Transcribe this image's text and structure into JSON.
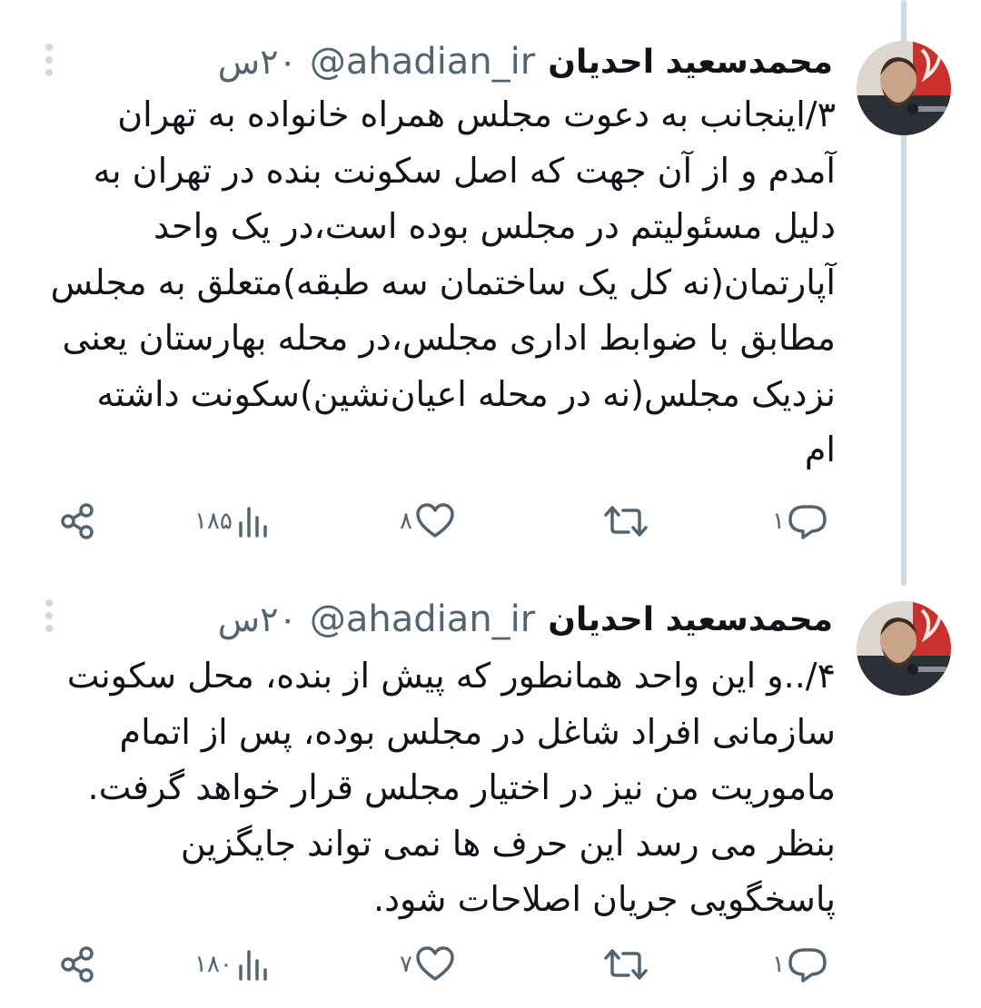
{
  "tweets": [
    {
      "author_name": "محمدسعید احدیان",
      "handle": "@ahadian_ir",
      "time": "۲۰س",
      "body_lines": [
        "۳/اینجانب به دعوت مجلس  همراه خانواده به تهران",
        "آمدم و از آن جهت که اصل سکونت بنده در تهران به",
        "دلیل مسئولیتم در مجلس بوده است،در  یک واحد",
        "آپارتمان(نه کل یک ساختمان سه طبقه)متعلق به مجلس",
        "مطابق با ضوابط اداری مجلس،در محله بهارستان یعنی",
        "نزدیک مجلس(نه در محله اعیان‌نشین)سکونت داشته",
        "ام"
      ],
      "replies": "۱",
      "likes": "۸",
      "views": "۱۸۵"
    },
    {
      "author_name": "محمدسعید احدیان",
      "handle": "@ahadian_ir",
      "time": "۲۰س",
      "body_lines": [
        "۴/..و این واحد همانطور که پیش از بنده، محل سکونت",
        "سازمانی افراد شاغل در مجلس بوده، پس از اتمام",
        "ماموریت من نیز در اختیار مجلس قرار خواهد گرفت.",
        "بنظر می رسد  این حرف ها نمی تواند جایگزین",
        "پاسخگویی جریان اصلاحات شود."
      ],
      "replies": "۱",
      "likes": "۷",
      "views": "۱۸۰"
    }
  ],
  "icons": {
    "more": "vertical-dots-icon",
    "share": "share-icon",
    "views": "views-chart-icon",
    "like": "heart-icon",
    "retweet": "retweet-icon",
    "reply": "reply-bubble-icon"
  },
  "colors": {
    "text": "#0f1419",
    "secondary": "#536471",
    "thread_line": "#cfd9de"
  }
}
